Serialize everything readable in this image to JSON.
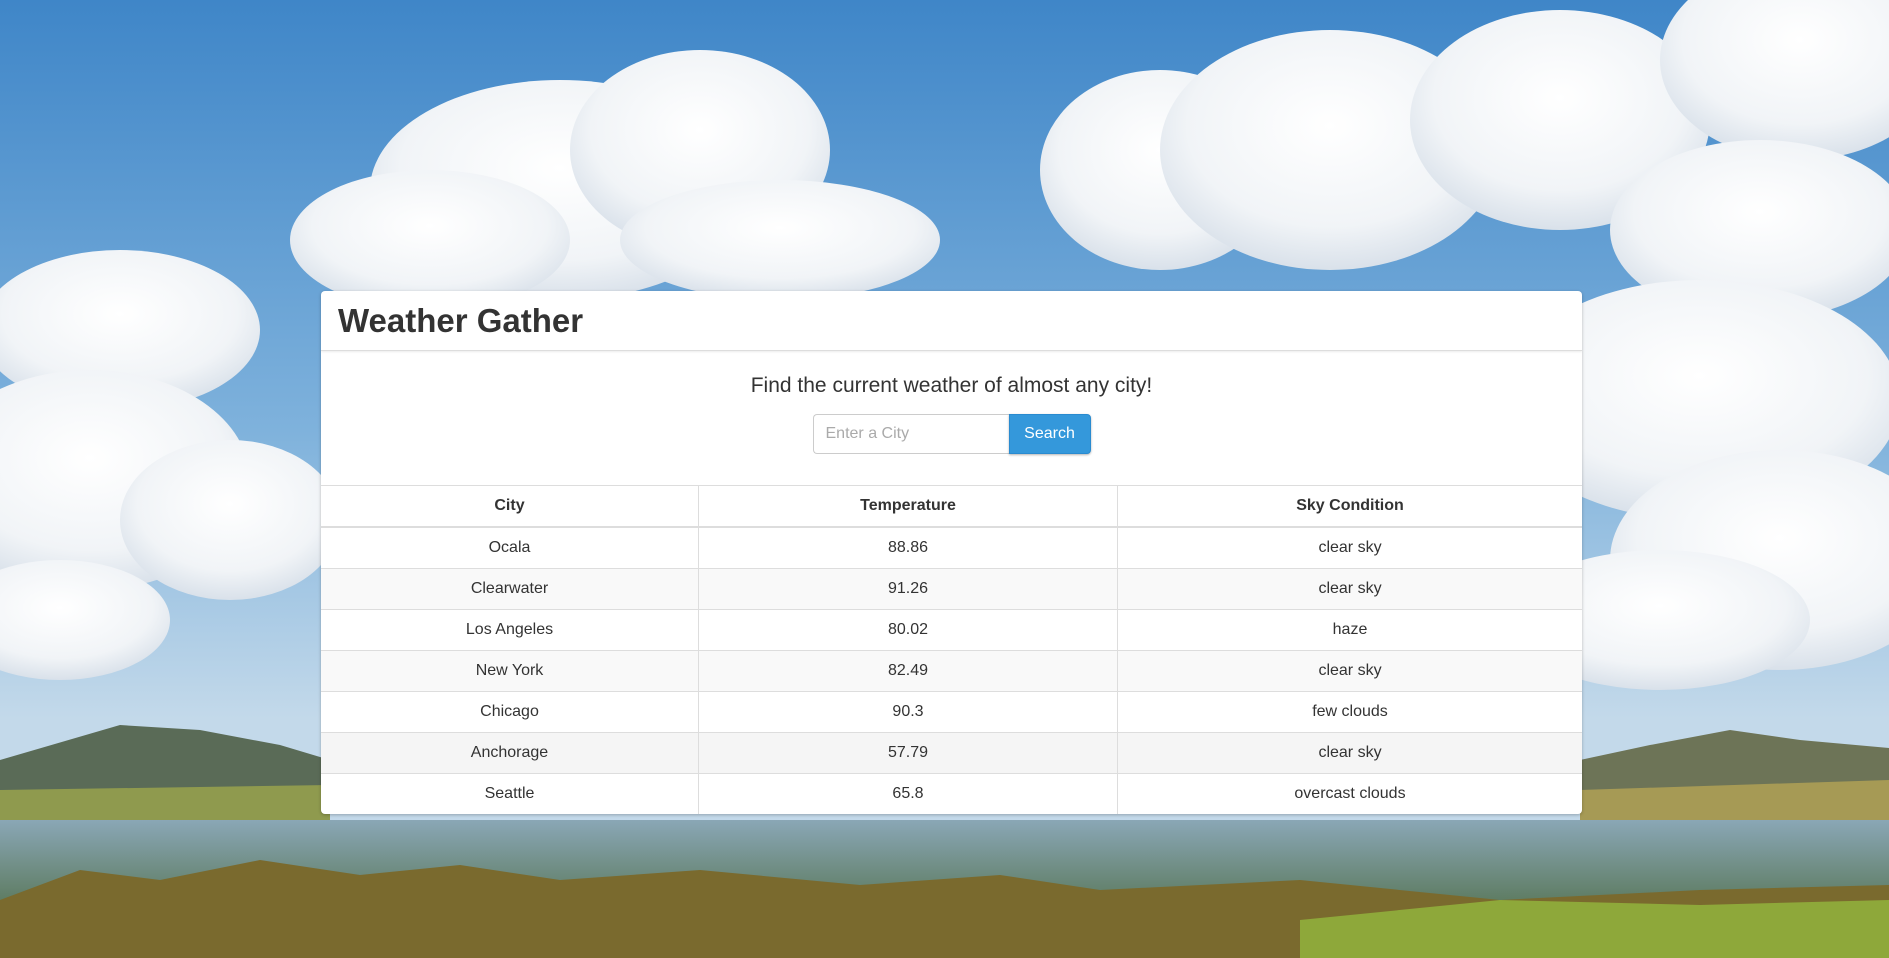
{
  "app": {
    "title": "Weather Gather",
    "tagline": "Find the current weather of almost any city!"
  },
  "search": {
    "placeholder": "Enter a City",
    "value": "",
    "button_label": "Search"
  },
  "table": {
    "columns": [
      "City",
      "Temperature",
      "Sky Condition"
    ],
    "rows": [
      [
        "Ocala",
        "88.86",
        "clear sky"
      ],
      [
        "Clearwater",
        "91.26",
        "clear sky"
      ],
      [
        "Los Angeles",
        "80.02",
        "haze"
      ],
      [
        "New York",
        "82.49",
        "clear sky"
      ],
      [
        "Chicago",
        "90.3",
        "few clouds"
      ],
      [
        "Anchorage",
        "57.79",
        "clear sky"
      ],
      [
        "Seattle",
        "65.8",
        "overcast clouds"
      ]
    ]
  },
  "colors": {
    "accent": "#3498db",
    "panel_bg": "#ffffff",
    "sky_top": "#4a8fcf",
    "sky_bottom": "#b8d4ea"
  }
}
